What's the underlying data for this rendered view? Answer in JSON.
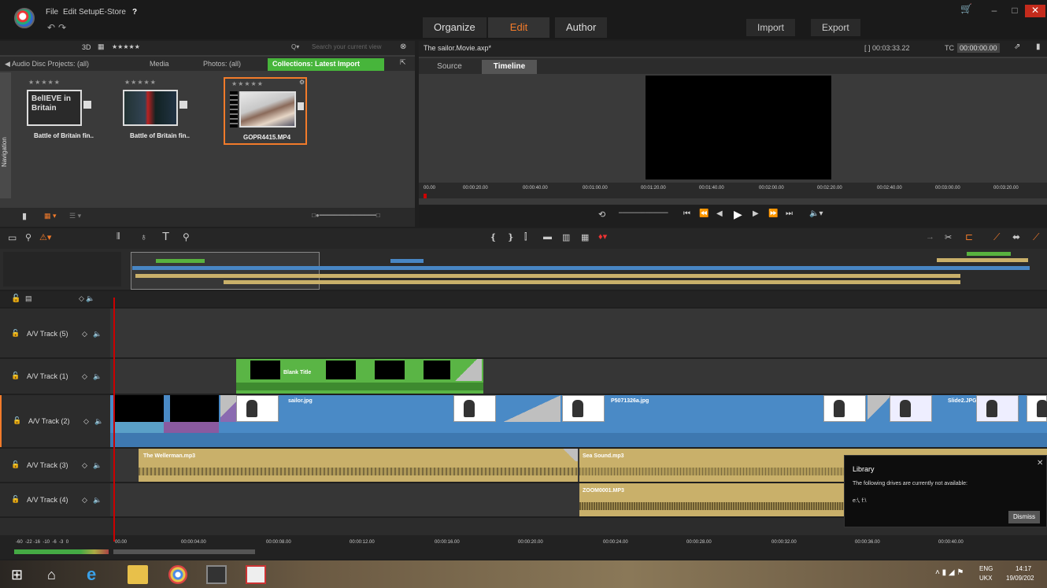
{
  "menu": {
    "file": "File",
    "edit": "Edit",
    "setup": "Setup",
    "estore": "E-Store",
    "help": "?"
  },
  "main_tabs": [
    {
      "label": "Organize"
    },
    {
      "label": "Edit"
    },
    {
      "label": "Author"
    }
  ],
  "top_buttons": {
    "import": "Import",
    "export": "Export"
  },
  "window_controls": {
    "minimize": "–",
    "maximize": "□",
    "close": "✕"
  },
  "library": {
    "view_mode": "3D",
    "rating_filter": "★★★★★",
    "search_placeholder": "Search your current view",
    "tabs": [
      {
        "label": "Audio Disc Projects: (all)"
      },
      {
        "label": "Media"
      },
      {
        "label": "Photos: (all)"
      },
      {
        "label": "Collections: Latest Import"
      }
    ],
    "nav_label": "Navigation",
    "items": [
      {
        "label": "Battle of Britain fin..",
        "stars": "★★★★★"
      },
      {
        "label": "Battle of Britain fin..",
        "stars": "★★★★★"
      },
      {
        "label": "GOPR4415.MP4",
        "stars": "★★★★★"
      }
    ],
    "thumb1_text": "BelIEVE in Britain"
  },
  "player": {
    "title": "The sailor.Movie.axp*",
    "duration": "[ ] 00:03:33.22",
    "tc_label": "TC",
    "tc_value": "00:00:00.00",
    "tabs": [
      {
        "label": "Source"
      },
      {
        "label": "Timeline"
      }
    ],
    "ruler": [
      "00.00",
      "00:00:20.00",
      "00:00:40.00",
      "00:01:00.00",
      "00:01:20.00",
      "00:01:40.00",
      "00:02:00.00",
      "00:02:20.00",
      "00:02:40.00",
      "00:03:00.00",
      "00:03:20.00"
    ]
  },
  "tracks": [
    {
      "name": "A/V Track (5)"
    },
    {
      "name": "A/V Track (1)"
    },
    {
      "name": "A/V Track (2)"
    },
    {
      "name": "A/V Track (3)"
    },
    {
      "name": "A/V Track (4)"
    }
  ],
  "clips": {
    "blank_title": "Blank Title",
    "sailor": "sailor.jpg",
    "p5071": "P5071326a.jpg",
    "slide2": "Slide2.JPG",
    "wellerman": "The Wellerman.mp3",
    "sea_sound": "Sea Sound.mp3",
    "zoom": "ZOOM0001.MP3"
  },
  "bottom_ruler": {
    "db_scale": "-60  -22 -16  -10  -6  -3  0",
    "ticks": [
      "00.00",
      "00:00:04.00",
      "00:00:08.00",
      "00:00:12.00",
      "00:00:16.00",
      "00:00:20.00",
      "00:00:24.00",
      "00:00:28.00",
      "00:00:32.00",
      "00:00:36.00",
      "00:00:40.00"
    ]
  },
  "notice": {
    "title": "Library",
    "message": "The following drives are currently not available:",
    "drives": "e:\\, f:\\",
    "dismiss": "Dismiss"
  },
  "taskbar": {
    "lang": "ENG",
    "region": "UKX",
    "time": "14:17",
    "date": "19/09/202"
  }
}
